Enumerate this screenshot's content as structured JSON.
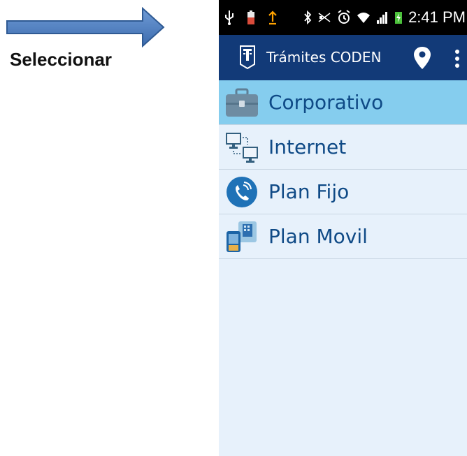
{
  "annotation": {
    "label": "Seleccionar",
    "arrow_color": "#4a7bbf"
  },
  "status_bar": {
    "time": "2:41 PM"
  },
  "app_bar": {
    "title": "Trámites CODEN",
    "background": "#123a78"
  },
  "menu": {
    "items": [
      {
        "label": "Corporativo",
        "icon": "briefcase-icon",
        "selected": true
      },
      {
        "label": "Internet",
        "icon": "network-computers-icon",
        "selected": false
      },
      {
        "label": "Plan Fijo",
        "icon": "phone-call-icon",
        "selected": false
      },
      {
        "label": "Plan Movil",
        "icon": "mobile-plan-icon",
        "selected": false
      }
    ],
    "selected_color": "#85cdee",
    "text_color": "#0f4a86"
  }
}
